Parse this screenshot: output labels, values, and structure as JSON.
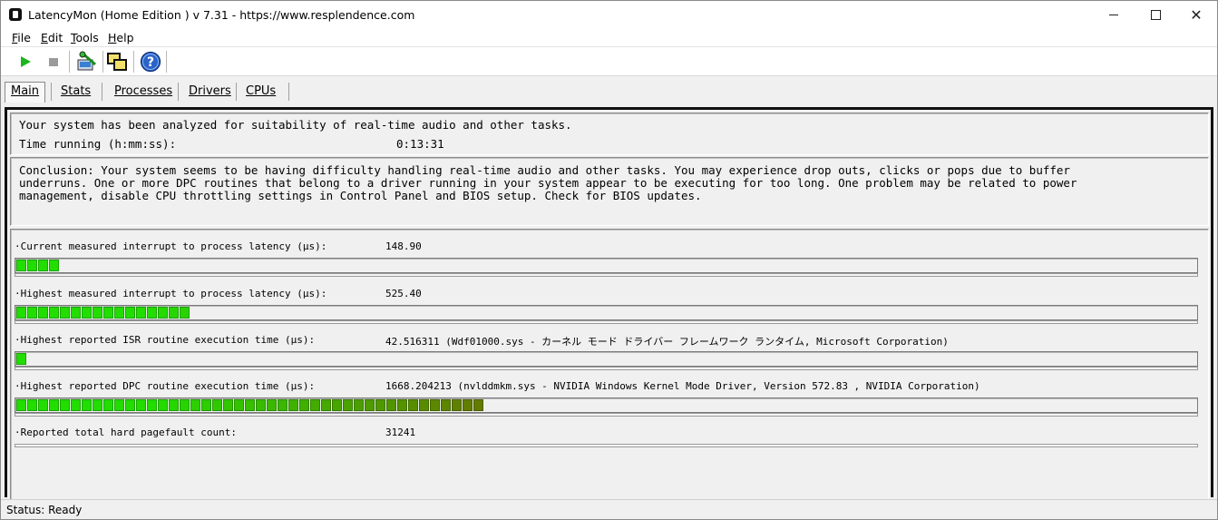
{
  "window": {
    "title": "LatencyMon  (Home Edition )  v 7.31 - https://www.resplendence.com"
  },
  "menu": [
    "File",
    "Edit",
    "Tools",
    "Help"
  ],
  "toolbar": {
    "buttons": [
      {
        "icon": "play-icon",
        "color": "#1db41d"
      },
      {
        "icon": "stop-icon",
        "color": "#9a9a9a"
      },
      {
        "icon": "monitor-tools-icon"
      },
      {
        "icon": "windows-icon"
      },
      {
        "icon": "help-icon",
        "color": "#2a63c8"
      }
    ]
  },
  "tabs": [
    "Main",
    "Stats",
    "Processes",
    "Drivers",
    "CPUs"
  ],
  "summary": {
    "line1": "Your system has been analyzed for suitability of real-time audio and other tasks.",
    "time_label": "Time running (h:mm:ss):",
    "time_value": "0:13:31"
  },
  "conclusion": {
    "line1": "Conclusion: Your system seems to be having difficulty handling real-time audio and other tasks. You may experience drop outs, clicks or pops due to buffer",
    "line2": "underruns. One or more DPC routines that belong to a driver running in your system appear to be executing for too long. One problem may be related to power",
    "line3": "management, disable CPU throttling settings in Control Panel and BIOS setup. Check for BIOS updates."
  },
  "metrics": [
    {
      "label": "·Current measured interrupt to process latency (µs):",
      "value": "148.90",
      "segments": 4
    },
    {
      "label": "·Highest measured interrupt to process latency (µs):",
      "value": "525.40",
      "segments": 16
    },
    {
      "label": "·Highest reported ISR routine execution time (µs):",
      "value": "42.516311  (Wdf01000.sys - カーネル モード ドライバー フレームワーク ランタイム, Microsoft Corporation)",
      "segments": 1
    },
    {
      "label": "·Highest reported DPC routine execution time (µs):",
      "value": "1668.204213  (nvlddmkm.sys - NVIDIA Windows Kernel Mode Driver, Version 572.83 , NVIDIA Corporation)",
      "segments": 43
    },
    {
      "label": "·Reported total hard pagefault count:",
      "value": "31241",
      "segments": 0
    }
  ],
  "colors": {
    "bar_green": "#22dd00",
    "bar_olive": "#7a5a00"
  },
  "status": "Status: Ready"
}
